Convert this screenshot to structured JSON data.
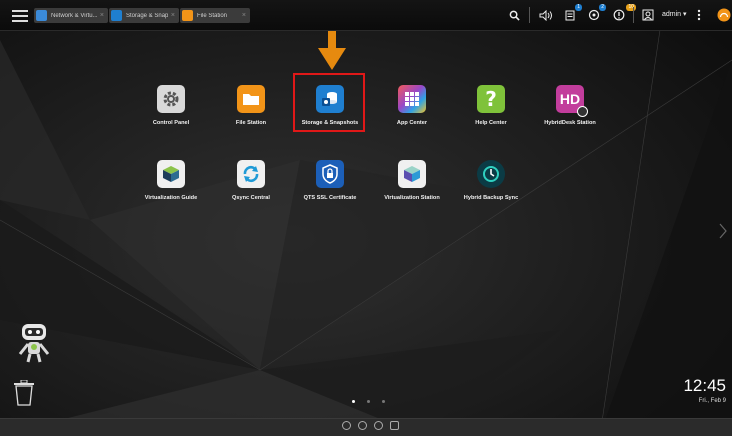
{
  "taskbar": {
    "tabs": [
      {
        "label": "Network & Virtu...",
        "icon": "network-icon"
      },
      {
        "label": "Storage & Snap...",
        "icon": "storage-icon"
      },
      {
        "label": "File Station",
        "icon": "folder-icon"
      }
    ],
    "notification_badges": {
      "tasks": "1",
      "events": "2",
      "news": "10"
    },
    "user": "admin ▾"
  },
  "apps": [
    {
      "label": "Control Panel",
      "icon": "gear-icon",
      "color": "#d9d9d9"
    },
    {
      "label": "File Station",
      "icon": "folder-icon",
      "color": "#f29418"
    },
    {
      "label": "Storage & Snapshots",
      "icon": "storage-icon",
      "color": "#1f7fd0"
    },
    {
      "label": "App Center",
      "icon": "app-grid-icon",
      "color": "#f25a5a"
    },
    {
      "label": "Help Center",
      "icon": "question-icon",
      "color": "#7fc23a"
    },
    {
      "label": "HybridDesk Station",
      "icon": "hd-icon",
      "color": "#c23d9c"
    },
    {
      "label": "Virtualization Guide",
      "icon": "cube-icon",
      "color": "#f0f0f0"
    },
    {
      "label": "Qsync Central",
      "icon": "sync-icon",
      "color": "#f0f0f0"
    },
    {
      "label": "QTS SSL Certificate",
      "icon": "shield-icon",
      "color": "#1c5fb8"
    },
    {
      "label": "Virtualization Station",
      "icon": "cube-color-icon",
      "color": "#f0f0f0"
    },
    {
      "label": "Hybrid Backup Sync",
      "icon": "backup-icon",
      "color": "#0b3b45"
    }
  ],
  "clock": {
    "time": "12:45",
    "date": "Fri., Feb 9"
  },
  "annotation": {
    "arrow_color": "#e68a0f",
    "box_color": "#e01818"
  }
}
